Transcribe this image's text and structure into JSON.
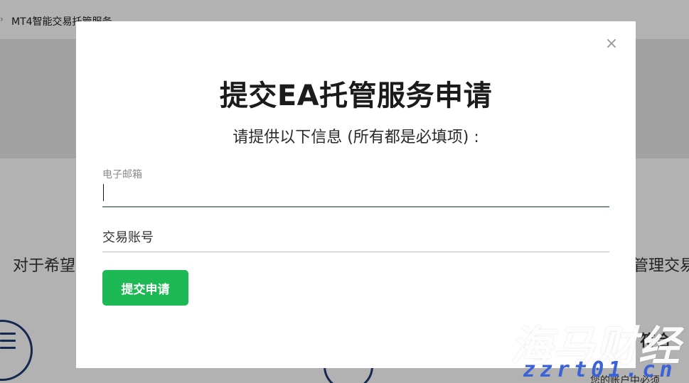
{
  "background": {
    "breadcrumb": "MT4智能交易托管服务",
    "text_left": "对于希望",
    "text_right": "管理交易",
    "text_right2": "符合",
    "text_right3": "您的账户中必须"
  },
  "modal": {
    "title": "提交EA托管服务申请",
    "subtitle": "请提供以下信息 (所有都是必填项) :",
    "close_label": "×",
    "email_label": "电子邮箱",
    "email_value": "",
    "account_placeholder": "交易账号",
    "submit_label": "提交申请"
  },
  "watermark": {
    "main": "海马财经",
    "sub": "zzrt01.cn"
  },
  "colors": {
    "accent": "#1db954",
    "overlay": "rgba(0,0,0,0.30)",
    "watermark_blue": "#3b63d6"
  }
}
